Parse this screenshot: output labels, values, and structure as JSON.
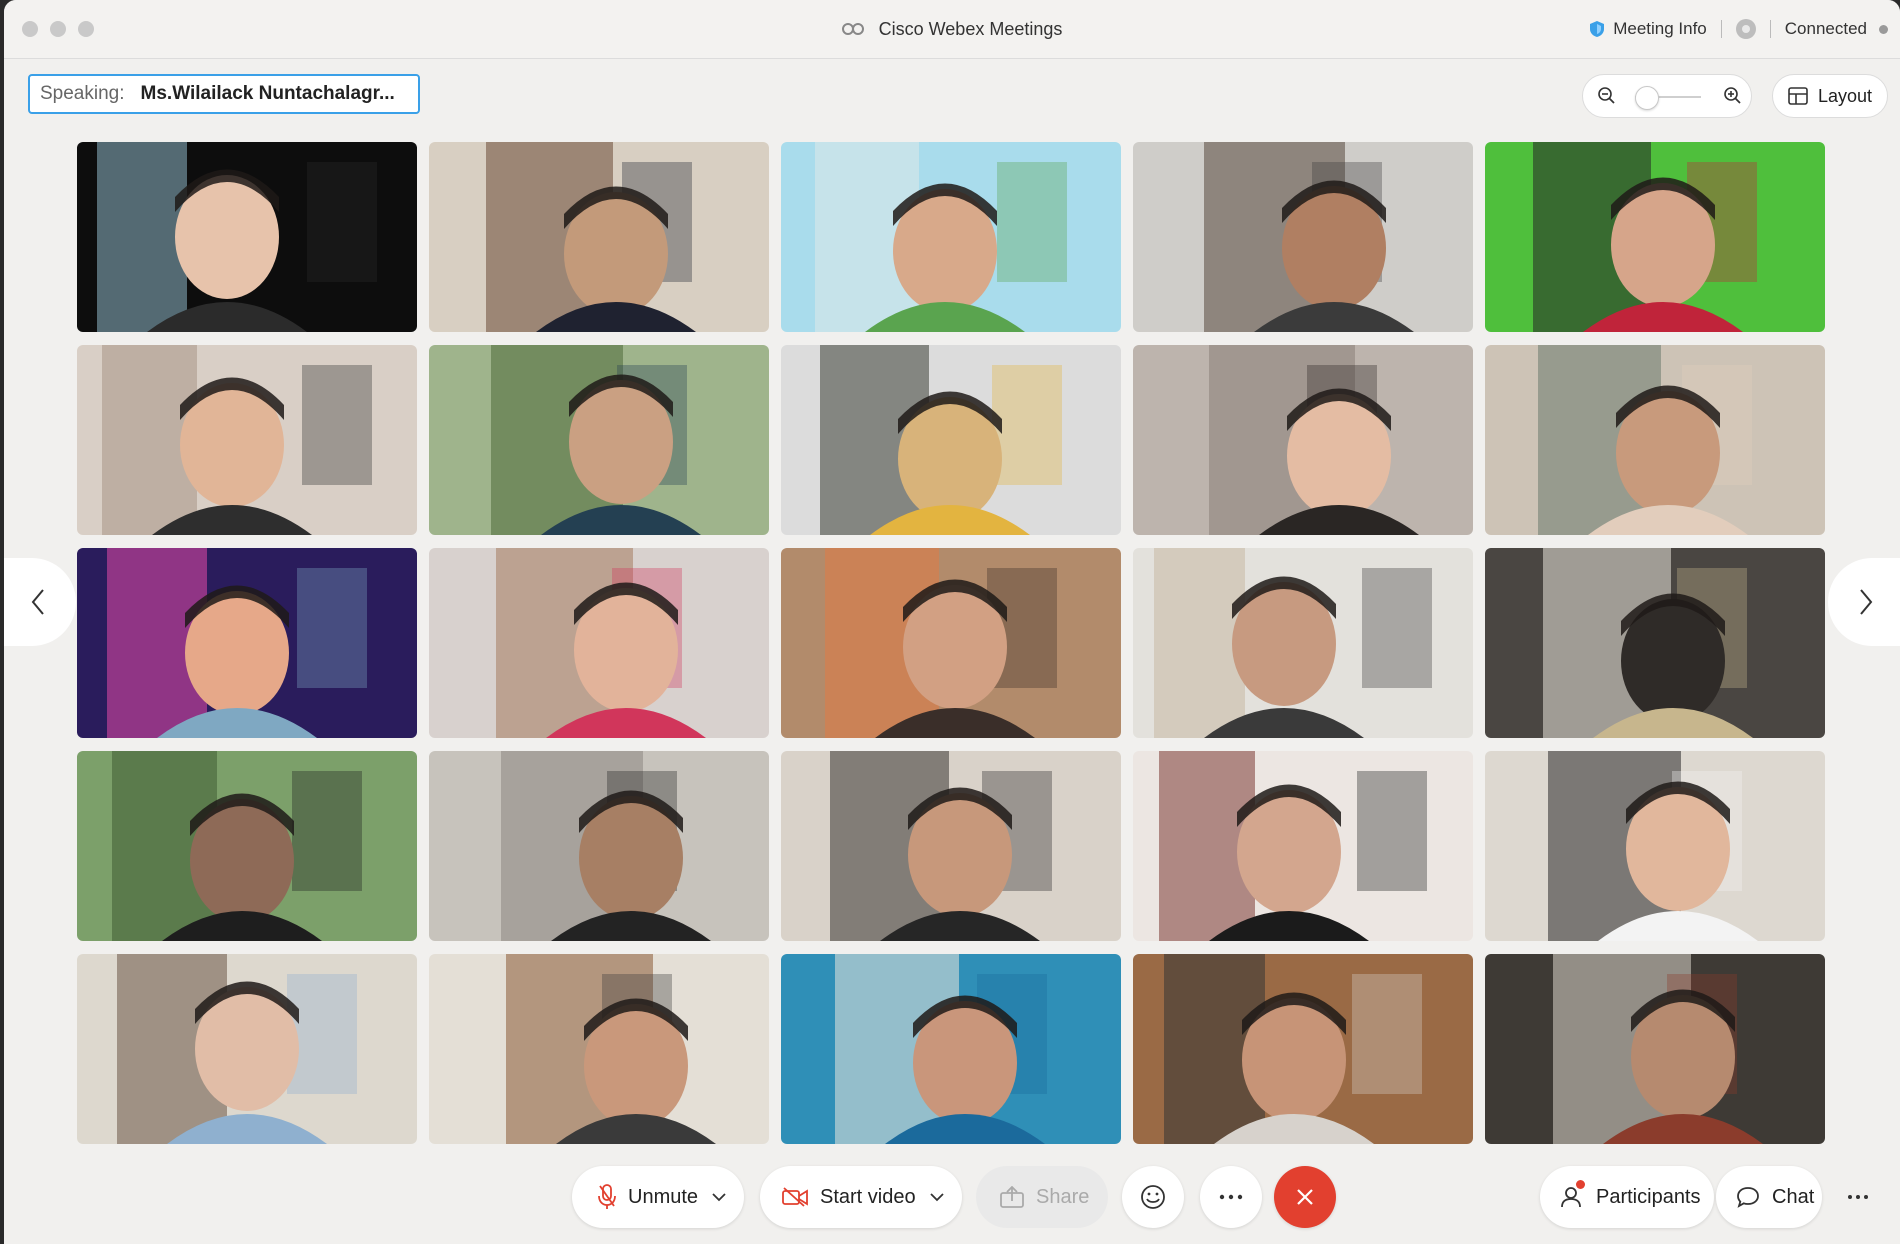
{
  "window": {
    "title": "Cisco Webex Meetings",
    "meeting_info_label": "Meeting Info",
    "connection_status": "Connected"
  },
  "speaking": {
    "label": "Speaking:",
    "name": "Ms.Wilailack Nuntachalagr..."
  },
  "view": {
    "layout_label": "Layout",
    "zoom_level": 0
  },
  "toolbar": {
    "unmute_label": "Unmute",
    "start_video_label": "Start video",
    "share_label": "Share",
    "participants_label": "Participants",
    "chat_label": "Chat"
  },
  "colors": {
    "accent": "#3aa0e8",
    "end_call": "#e2402f",
    "window_bg": "#f1f0ee"
  },
  "icons": [
    "webex-logo-icon",
    "shield-icon",
    "recording-icon",
    "zoom-out-icon",
    "zoom-in-icon",
    "layout-grid-icon",
    "chevron-left-icon",
    "chevron-right-icon",
    "mic-muted-icon",
    "video-off-icon",
    "share-icon",
    "emoji-icon",
    "more-icon",
    "close-icon",
    "participants-icon",
    "chat-icon"
  ],
  "tiles": [
    {
      "id": 1,
      "bg": "#0d0d0d",
      "mid": "#8fb8c8",
      "fg": "#e7c3ab",
      "acc": "#2b2b2b"
    },
    {
      "id": 2,
      "bg": "#d8cfc2",
      "mid": "#6b4a36",
      "fg": "#c39a7a",
      "acc": "#1f2230"
    },
    {
      "id": 3,
      "bg": "#a9dcec",
      "mid": "#dfe9e9",
      "fg": "#d8a98a",
      "acc": "#5aa44f"
    },
    {
      "id": 4,
      "bg": "#cfcdc9",
      "mid": "#5a4b3e",
      "fg": "#b07f62",
      "acc": "#3b3b3b"
    },
    {
      "id": 5,
      "bg": "#4fbf3c",
      "mid": "#262626",
      "fg": "#d6a58a",
      "acc": "#c0243a"
    },
    {
      "id": 6,
      "bg": "#d9cfc6",
      "mid": "#a89686",
      "fg": "#e1b597",
      "acc": "#2e2e2e"
    },
    {
      "id": 7,
      "bg": "#9fb48c",
      "mid": "#4e6b3a",
      "fg": "#caa082",
      "acc": "#244052"
    },
    {
      "id": 8,
      "bg": "#dcdcdc",
      "mid": "#3d3f36",
      "fg": "#d8b37a",
      "acc": "#e3b440"
    },
    {
      "id": 9,
      "bg": "#bdb4ad",
      "mid": "#8b7f78",
      "fg": "#e4bca3",
      "acc": "#2a2624"
    },
    {
      "id": 10,
      "bg": "#cdc3b6",
      "mid": "#6c7a6e",
      "fg": "#c89a7c",
      "acc": "#e2cdbc"
    },
    {
      "id": 11,
      "bg": "#2a1c5c",
      "mid": "#e44aa7",
      "fg": "#e6a889",
      "acc": "#7fa8c2"
    },
    {
      "id": 12,
      "bg": "#d8d1ce",
      "mid": "#a67c5f",
      "fg": "#e2b39a",
      "acc": "#d1365b"
    },
    {
      "id": 13,
      "bg": "#b28b6b",
      "mid": "#e07c46",
      "fg": "#d2a083",
      "acc": "#3a2e29"
    },
    {
      "id": 14,
      "bg": "#e3e1dc",
      "mid": "#c9b9a4",
      "fg": "#c79a80",
      "acc": "#3a3a3a"
    },
    {
      "id": 15,
      "bg": "#4a4642",
      "mid": "#e8e4db",
      "fg": "#2f2b28",
      "acc": "#c7b68d"
    },
    {
      "id": 16,
      "bg": "#7ca06a",
      "mid": "#3f5d33",
      "fg": "#8e6a57",
      "acc": "#1e1e1e"
    },
    {
      "id": 17,
      "bg": "#c7c3bc",
      "mid": "#8d8782",
      "fg": "#a77f64",
      "acc": "#232323"
    },
    {
      "id": 18,
      "bg": "#d9d2c9",
      "mid": "#3b3733",
      "fg": "#c7987b",
      "acc": "#262626"
    },
    {
      "id": 19,
      "bg": "#ece6e2",
      "mid": "#7d3a35",
      "fg": "#d3a68e",
      "acc": "#1b1b1b"
    },
    {
      "id": 20,
      "bg": "#ddd8d0",
      "mid": "#2a2a2a",
      "fg": "#e1b79c",
      "acc": "#f3f3f3"
    },
    {
      "id": 21,
      "bg": "#ddd8ce",
      "mid": "#6b5747",
      "fg": "#e1bda7",
      "acc": "#8fb0cf"
    },
    {
      "id": 22,
      "bg": "#e4dfd6",
      "mid": "#8b5a36",
      "fg": "#c9987b",
      "acc": "#3a3a3a"
    },
    {
      "id": 23,
      "bg": "#2f8fb7",
      "mid": "#e8e5dc",
      "fg": "#c9967b",
      "acc": "#1b6a9c"
    },
    {
      "id": 24,
      "bg": "#9a6a45",
      "mid": "#343434",
      "fg": "#c79477",
      "acc": "#d7d2cc"
    },
    {
      "id": 25,
      "bg": "#3e3a35",
      "mid": "#d9d4c8",
      "fg": "#b68a6f",
      "acc": "#8b3c2c"
    }
  ]
}
